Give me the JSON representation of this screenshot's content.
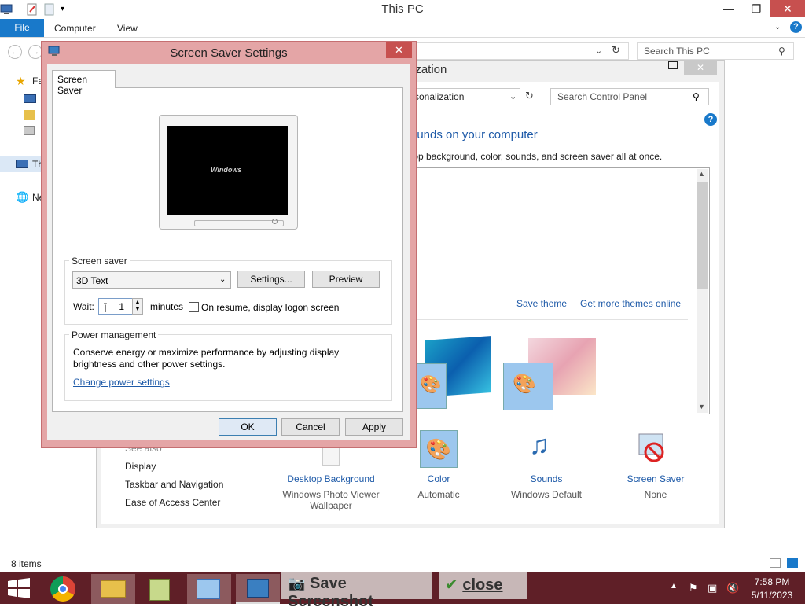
{
  "explorer": {
    "title": "This PC",
    "ribbon": {
      "file": "File",
      "computer": "Computer",
      "view": "View"
    },
    "search_placeholder": "Search This PC",
    "nav_pane": [
      {
        "label": "Fa",
        "icon": "star-icon"
      },
      {
        "label": "Th",
        "icon": "computer-icon"
      },
      {
        "label": "Ne",
        "icon": "network-icon"
      }
    ],
    "status": "8 items"
  },
  "control_panel": {
    "title": "ization",
    "address": "rsonalization",
    "search_placeholder": "Search Control Panel",
    "heading": "ounds on your computer",
    "subtitle": "top background, color, sounds, and screen saver all at once.",
    "save_theme": "Save theme",
    "get_more_themes": "Get more themes online",
    "see_also_heading": "See also",
    "see_also": [
      "Display",
      "Taskbar and Navigation",
      "Ease of Access Center"
    ],
    "bottom_items": [
      {
        "label": "Desktop Background",
        "sub": "Windows Photo Viewer Wallpaper"
      },
      {
        "label": "Color",
        "sub": "Automatic"
      },
      {
        "label": "Sounds",
        "sub": "Windows Default"
      },
      {
        "label": "Screen Saver",
        "sub": "None"
      }
    ]
  },
  "dialog": {
    "title": "Screen Saver Settings",
    "tab": "Screen Saver",
    "preview_text": "Windows",
    "screen_saver_group": "Screen saver",
    "selected_saver": "3D Text",
    "settings_button": "Settings...",
    "preview_button": "Preview",
    "wait_label": "Wait:",
    "wait_value": "1",
    "minutes_label": "minutes",
    "resume_label": "On resume, display logon screen",
    "resume_checked": false,
    "power_group": "Power management",
    "power_text": "Conserve energy or maximize performance by adjusting display brightness and other power settings.",
    "power_link": "Change power settings",
    "ok": "OK",
    "cancel": "Cancel",
    "apply": "Apply"
  },
  "taskbar": {
    "time": "7:58 PM",
    "date": "5/11/2023",
    "overlay_save": "Save Screenshot",
    "overlay_close": "close"
  }
}
